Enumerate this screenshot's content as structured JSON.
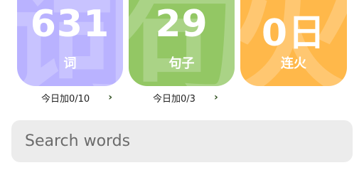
{
  "stats": {
    "words": {
      "count": "631",
      "label": "词",
      "bg_char": "词",
      "color": "#b9b2ff"
    },
    "sentences": {
      "count": "29",
      "label": "句子",
      "bg_char": "句",
      "color": "#93c764"
    },
    "streak": {
      "count": "0日",
      "label": "连火",
      "bg_char": "火",
      "color": "#ffb84a"
    }
  },
  "today": {
    "words": "今日加0/10",
    "sentences": "今日加0/3"
  },
  "search": {
    "placeholder": "Search words",
    "value": ""
  }
}
